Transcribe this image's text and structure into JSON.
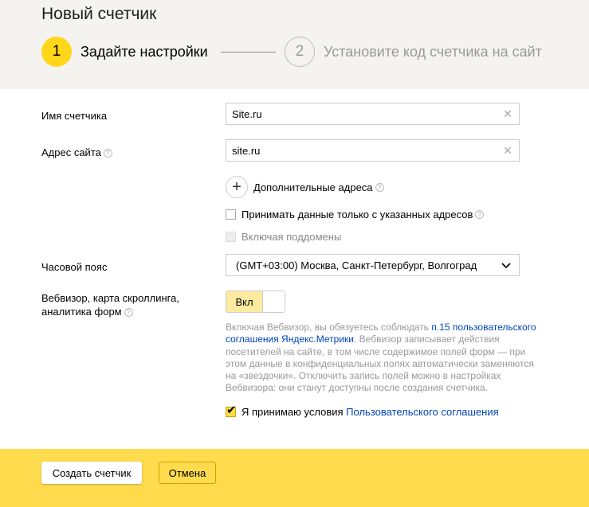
{
  "page": {
    "title": "Новый счетчик"
  },
  "steps": [
    {
      "number": "1",
      "label": "Задайте настройки",
      "active": true
    },
    {
      "number": "2",
      "label": "Установите код счетчика на сайт",
      "active": false
    }
  ],
  "form": {
    "counter_name": {
      "label": "Имя счетчика",
      "value": "Site.ru"
    },
    "site_address": {
      "label": "Адрес сайта",
      "value": "site.ru"
    },
    "additional_addresses": {
      "label": "Дополнительные адреса"
    },
    "only_specified": {
      "label": "Принимать данные только с указанных адресов",
      "checked": false
    },
    "subdomains": {
      "label": "Включая поддомены",
      "checked": false,
      "disabled": true
    },
    "timezone": {
      "label": "Часовой пояс",
      "value": "(GMT+03:00) Москва, Санкт-Петербург, Волгоград"
    },
    "webvisor": {
      "label_line1": "Вебвизор, карта скроллинга,",
      "label_line2": "аналитика форм",
      "toggle_label": "Вкл",
      "enabled": true
    },
    "info": {
      "text_before": "Включая Вебвизор, вы обязуетесь соблюдать ",
      "link_text": "п.15 пользовательского соглашения Яндекс.Метрики",
      "text_after": ". Вебвизор записывает действия посетителей на сайте, в том числе содержимое полей форм — при этом данные в конфиденциальных полях автоматически заменяются на «звездочки». Отключить запись полей можно в настройках Вебвизора: они станут доступны после создания счетчика."
    },
    "agreement": {
      "text": "Я принимаю условия ",
      "link_text": "Пользовательского соглашения",
      "checked": true
    }
  },
  "footer": {
    "create_label": "Создать счетчик",
    "cancel_label": "Отмена"
  },
  "icons": {
    "help": "question-icon",
    "clear": "close-icon",
    "plus": "plus-icon",
    "dropdown": "chevron-down-icon"
  },
  "colors": {
    "accent": "#ffdb4d",
    "step_active": "#ffd619",
    "link": "#0044bb",
    "header_bg": "#f4f3f0"
  }
}
